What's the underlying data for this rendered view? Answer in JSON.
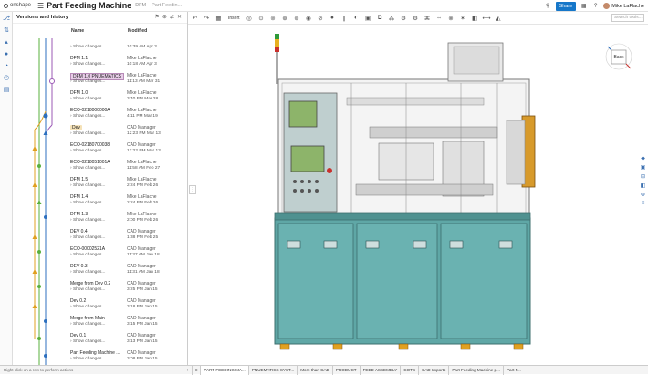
{
  "topbar": {
    "logo_label": "onshape",
    "doc_title": "Part Feeding Machine",
    "branch": "DFM",
    "breadcrumb": "Part Feedin...",
    "share_label": "Share",
    "user_name": "Mike LaFlache",
    "help_label": "?"
  },
  "panel": {
    "title": "Versions and history",
    "col_name": "Name",
    "col_modified": "Modified"
  },
  "rows": [
    {
      "name": "",
      "sub": "Show changes...",
      "who": "",
      "when": "10:39 AM Apr 3",
      "tag": ""
    },
    {
      "name": "DFM 1.1",
      "sub": "Show changes...",
      "who": "Mike LaFlache",
      "when": "10:18 AM Apr 3",
      "tag": ""
    },
    {
      "name": "DFM 1.0 PNUEMATICS",
      "sub": "Show changes...",
      "who": "Mike LaFlache",
      "when": "11:13 AM Mar 31",
      "tag": "p"
    },
    {
      "name": "DFM 1.0",
      "sub": "Show changes...",
      "who": "Mike LaFlache",
      "when": "3:40 PM Mar 28",
      "tag": ""
    },
    {
      "name": "ECO-0218000000A",
      "sub": "Show changes...",
      "who": "Mike LaFlache",
      "when": "4:11 PM Mar 19",
      "tag": ""
    },
    {
      "name": "Dev",
      "sub": "Show changes...",
      "who": "CAD Manager",
      "when": "12:23 PM Mar 13",
      "tag": "y"
    },
    {
      "name": "ECO-02180700038",
      "sub": "Show changes...",
      "who": "CAD Manager",
      "when": "12:22 PM Mar 13",
      "tag": ""
    },
    {
      "name": "ECO-0218051001A",
      "sub": "Show changes...",
      "who": "Mike LaFlache",
      "when": "11:58 AM Feb 27",
      "tag": ""
    },
    {
      "name": "DFM 1.5",
      "sub": "Show changes...",
      "who": "Mike LaFlache",
      "when": "2:24 PM Feb 26",
      "tag": ""
    },
    {
      "name": "DFM 1.4",
      "sub": "Show changes...",
      "who": "Mike LaFlache",
      "when": "2:24 PM Feb 26",
      "tag": ""
    },
    {
      "name": "DFM 1.3",
      "sub": "Show changes...",
      "who": "Mike LaFlache",
      "when": "2:00 PM Feb 26",
      "tag": ""
    },
    {
      "name": "DEV 0.4",
      "sub": "Show changes...",
      "who": "CAD Manager",
      "when": "1:38 PM Feb 25",
      "tag": ""
    },
    {
      "name": "ECO-00002521A",
      "sub": "Show changes...",
      "who": "CAD Manager",
      "when": "11:37 AM Jan 18",
      "tag": ""
    },
    {
      "name": "DEV 0.3",
      "sub": "Show changes...",
      "who": "CAD Manager",
      "when": "11:31 AM Jan 18",
      "tag": ""
    },
    {
      "name": "Merge from Dev 0.2",
      "sub": "Show changes...",
      "who": "CAD Manager",
      "when": "3:25 PM Jan 15",
      "tag": ""
    },
    {
      "name": "Dev 0.2",
      "sub": "Show changes...",
      "who": "CAD Manager",
      "when": "3:18 PM Jan 15",
      "tag": ""
    },
    {
      "name": "Merge from Main",
      "sub": "Show changes...",
      "who": "CAD Manager",
      "when": "3:15 PM Jan 15",
      "tag": ""
    },
    {
      "name": "Dev 0.1",
      "sub": "Show changes...",
      "who": "CAD Manager",
      "when": "3:13 PM Jan 15",
      "tag": ""
    },
    {
      "name": "Part Feeding Machine ...",
      "sub": "Show changes...",
      "who": "CAD Manager",
      "when": "3:08 PM Jan 15",
      "tag": ""
    }
  ],
  "toolbar": {
    "insert_label": "Insert",
    "search_placeholder": "Search tools..."
  },
  "viewcube": {
    "label": "Back"
  },
  "status": {
    "text": "Right click on a row to perform actions"
  },
  "tabs": [
    {
      "label": "PART FEEDING MA..."
    },
    {
      "label": "PNUEMATICS SYST..."
    },
    {
      "label": "More than CAD"
    },
    {
      "label": "PRODUCT"
    },
    {
      "label": "FEED ASSEMBLY"
    },
    {
      "label": "COTS"
    },
    {
      "label": "CAD Imports"
    },
    {
      "label": "Part Feeding Machine p..."
    },
    {
      "label": "Part F..."
    }
  ],
  "colors": {
    "accent": "#1677c9",
    "machine_teal": "#5fa7a6",
    "frame_gray": "#c9c9c9"
  }
}
